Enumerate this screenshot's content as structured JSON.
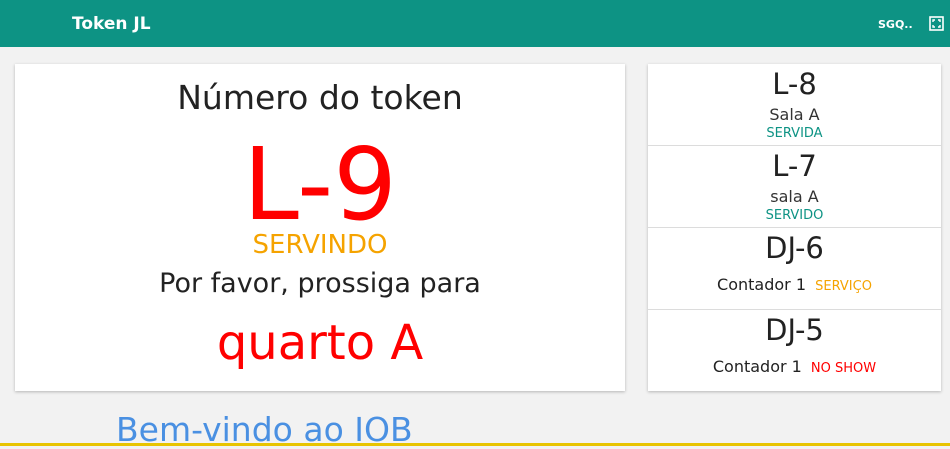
{
  "header": {
    "title": "Token JL",
    "user_label": "SGQ..",
    "fullscreen_icon": "fullscreen-icon"
  },
  "current": {
    "heading": "Número do token",
    "token": "L-9",
    "status": "SERVINDO",
    "message": "Por favor, prossiga para",
    "room": "quarto A"
  },
  "queue": [
    {
      "token": "L-8",
      "room": "Sala A",
      "status": "SERVIDA"
    },
    {
      "token": "L-7",
      "room": "sala A",
      "status": "SERVIDO"
    },
    {
      "token": "DJ-6",
      "room": "Contador 1",
      "status": "SERVIÇO"
    },
    {
      "token": "DJ-5",
      "room": "Contador 1",
      "status": "NO SHOW"
    }
  ],
  "welcome": "Bem-vindo ao IOB",
  "colors": {
    "header": "#0d9384",
    "token_red": "#ff0000",
    "serving_orange": "#f5a300",
    "served_teal": "#0d9384",
    "welcome_blue": "#4a90e2"
  }
}
